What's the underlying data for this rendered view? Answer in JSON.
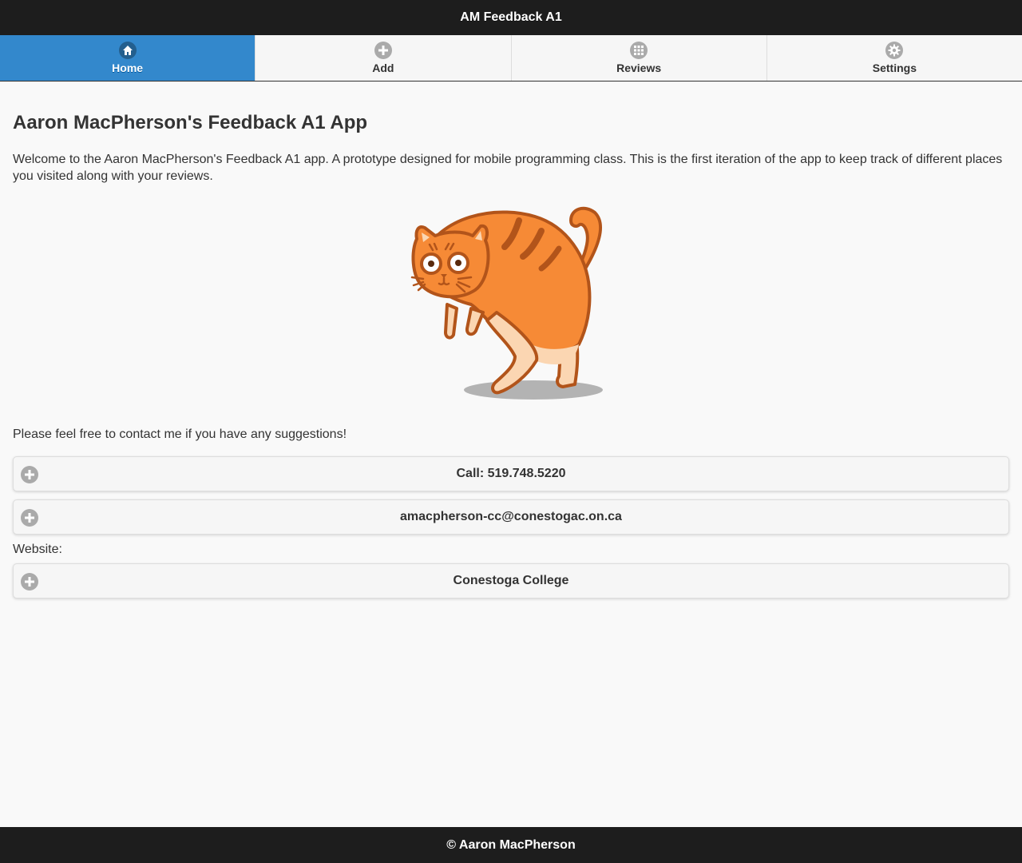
{
  "header": {
    "title": "AM Feedback A1"
  },
  "navbar": {
    "items": [
      {
        "label": "Home",
        "icon": "home-icon"
      },
      {
        "label": "Add",
        "icon": "plus-icon"
      },
      {
        "label": "Reviews",
        "icon": "grid-icon"
      },
      {
        "label": "Settings",
        "icon": "gear-icon"
      }
    ],
    "active_index": 0
  },
  "main": {
    "title": "Aaron MacPherson's Feedback A1 App",
    "intro": "Welcome to the Aaron MacPherson's Feedback A1 app. A prototype designed for mobile programming class. This is the first iteration of the app to keep track of different places you visited along with your reviews.",
    "illustration": "orange-cat-illustration",
    "contact_prompt": "Please feel free to contact me if you have any suggestions!",
    "buttons": {
      "call": "Call: 519.748.5220",
      "email": "amacpherson-cc@conestogac.on.ca"
    },
    "website_label": "Website:",
    "website_button": "Conestoga College"
  },
  "footer": {
    "text": "© Aaron MacPherson"
  },
  "colors": {
    "header_bg": "#1d1d1d",
    "active_tab": "#3388cc",
    "page_bg": "#f9f9f9",
    "cat_orange": "#f68a36",
    "cat_outline": "#b2541a"
  }
}
